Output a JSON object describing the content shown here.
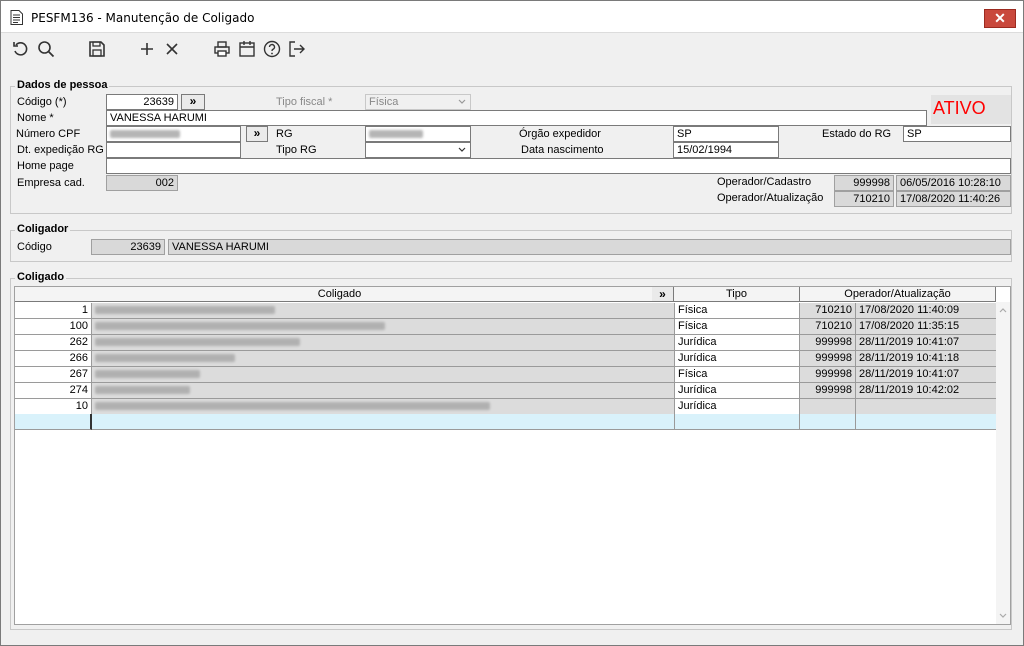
{
  "window": {
    "title": "PESFM136 - Manutenção de Coligado",
    "close_glyph": "✕"
  },
  "toolbar": {
    "icons": [
      "refresh-icon",
      "search-icon",
      "save-icon",
      "add-icon",
      "delete-icon",
      "print-icon",
      "calendar-icon",
      "help-icon",
      "exit-icon"
    ]
  },
  "dados": {
    "legend": "Dados de pessoa",
    "codigo_label": "Código (*)",
    "codigo_value": "23639",
    "arrow_button": "»",
    "tipo_fiscal_label": "Tipo fiscal *",
    "tipo_fiscal_value": "Física",
    "status": "ATIVO",
    "nome_label": "Nome *",
    "nome_value": "VANESSA HARUMI",
    "cpf_label": "Número CPF",
    "rg_label": "RG",
    "orgao_label": "Órgão expedidor",
    "orgao_value": "SP",
    "estado_rg_label": "Estado do RG",
    "estado_rg_value": "SP",
    "dt_exp_label": "Dt. expedição RG",
    "tipo_rg_label": "Tipo RG",
    "data_nasc_label": "Data nascimento",
    "data_nasc_value": "15/02/1994",
    "homepage_label": "Home page",
    "empresa_label": "Empresa cad.",
    "empresa_value": "002",
    "op_cad_label": "Operador/Cadastro",
    "op_cad_code": "999998",
    "op_cad_date": "06/05/2016 10:28:10",
    "op_atu_label": "Operador/Atualização",
    "op_atu_code": "710210",
    "op_atu_date": "17/08/2020 11:40:26"
  },
  "coligador": {
    "legend": "Coligador",
    "codigo_label": "Código",
    "codigo_value": "23639",
    "nome_value": "VANESSA HARUMI"
  },
  "coligado": {
    "legend": "Coligado",
    "headers": {
      "coligado": "Coligado",
      "arrow": "»",
      "tipo": "Tipo",
      "operador": "Operador/Atualização"
    },
    "rows": [
      {
        "code": "1",
        "tipo": "Física",
        "op": "710210",
        "date": "17/08/2020 11:40:09"
      },
      {
        "code": "100",
        "tipo": "Física",
        "op": "710210",
        "date": "17/08/2020 11:35:15"
      },
      {
        "code": "262",
        "tipo": "Jurídica",
        "op": "999998",
        "date": "28/11/2019 10:41:07"
      },
      {
        "code": "266",
        "tipo": "Jurídica",
        "op": "999998",
        "date": "28/11/2019 10:41:18"
      },
      {
        "code": "267",
        "tipo": "Física",
        "op": "999998",
        "date": "28/11/2019 10:41:07"
      },
      {
        "code": "274",
        "tipo": "Jurídica",
        "op": "999998",
        "date": "28/11/2019 10:42:02"
      },
      {
        "code": "10",
        "tipo": "Jurídica",
        "op": "",
        "date": ""
      }
    ]
  },
  "colors": {
    "status_red": "#ff0000",
    "new_row": "#d9f2fb",
    "readonly": "#d9d9d9"
  }
}
